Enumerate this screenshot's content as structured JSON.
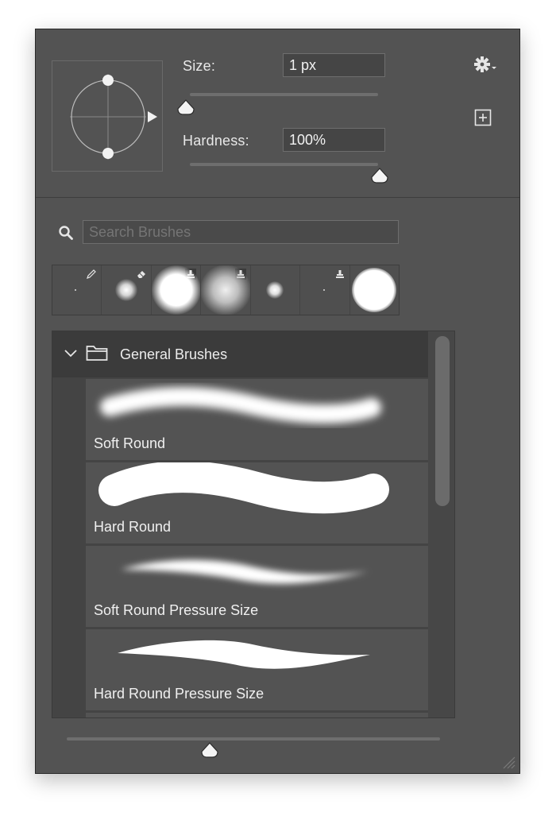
{
  "brush_settings": {
    "size_label": "Size:",
    "size_value": "1 px",
    "size_slider_fraction": 0.0,
    "hardness_label": "Hardness:",
    "hardness_value": "100%",
    "hardness_slider_fraction": 1.0
  },
  "toolbar": {
    "settings_icon": "gear-icon",
    "new_brush_icon": "plus-box-icon"
  },
  "search": {
    "placeholder": "Search Brushes",
    "icon": "search-icon"
  },
  "recent_brushes": [
    {
      "badge": "pencil-icon",
      "kind": "tiny-dot"
    },
    {
      "badge": "eraser-icon",
      "kind": "soft-small"
    },
    {
      "badge": "stamp-icon",
      "kind": "soft-large"
    },
    {
      "badge": "stamp-icon",
      "kind": "very-soft-large"
    },
    {
      "badge": "",
      "kind": "soft-tiny"
    },
    {
      "badge": "stamp-icon",
      "kind": "tiny-dot"
    },
    {
      "badge": "",
      "kind": "hard-large"
    }
  ],
  "brush_list": {
    "group_name": "General Brushes",
    "group_icon": "folder-icon",
    "items": [
      {
        "name": "Soft Round"
      },
      {
        "name": "Hard Round"
      },
      {
        "name": "Soft Round Pressure Size"
      },
      {
        "name": "Hard Round Pressure Size"
      }
    ]
  },
  "preview_size_slider_fraction": 0.38,
  "colors": {
    "panel_bg": "#535353",
    "list_bg": "#444444",
    "accent": "#ffffff"
  }
}
